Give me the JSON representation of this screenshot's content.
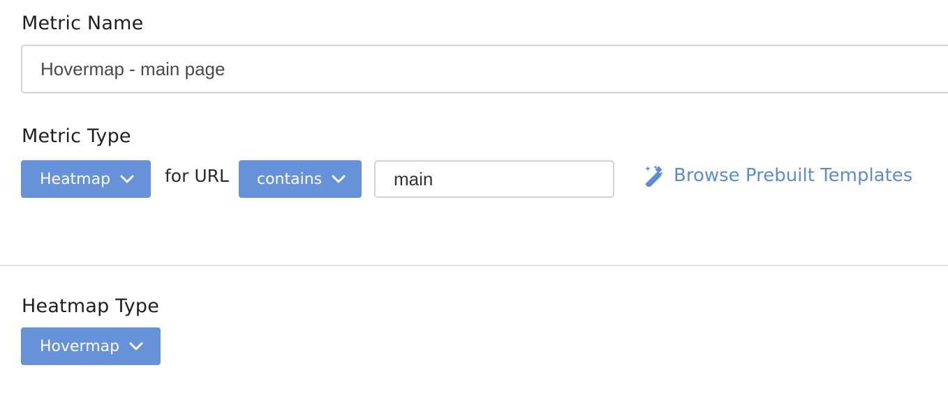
{
  "metric_name": {
    "label": "Metric Name",
    "value": "Hovermap - main page"
  },
  "metric_type": {
    "label": "Metric Type",
    "type_dropdown": "Heatmap",
    "for_url_text": "for URL",
    "url_match_dropdown": "contains",
    "url_value": "main",
    "browse_link": "Browse Prebuilt Templates"
  },
  "heatmap_type": {
    "label": "Heatmap Type",
    "dropdown": "Hovermap"
  },
  "colors": {
    "button_bg": "#6592d9",
    "link": "#5b8cd6",
    "border": "#d3d3d3"
  },
  "icons": {
    "dropdown": "chevron-down-icon",
    "browse": "magic-wand-icon"
  }
}
